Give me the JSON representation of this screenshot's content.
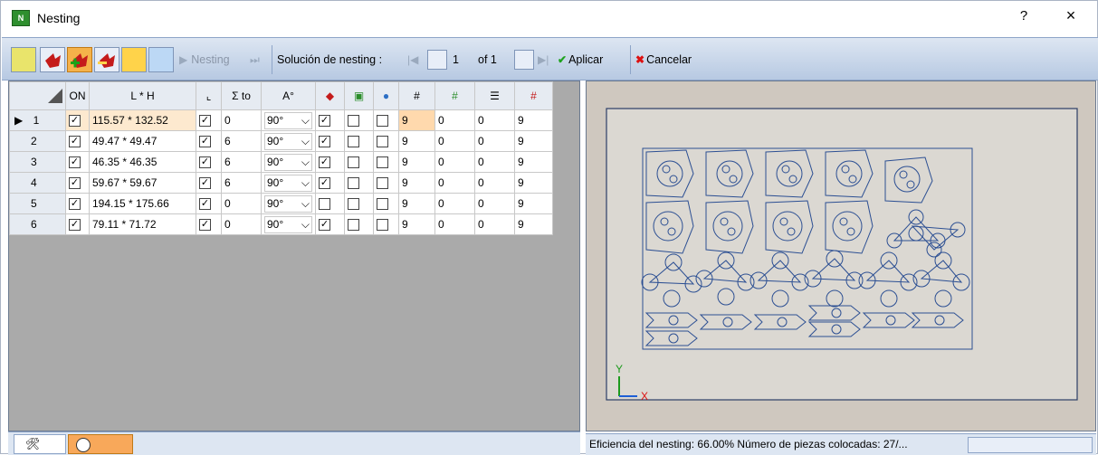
{
  "window": {
    "title": "Nesting",
    "help": "?",
    "close": "×"
  },
  "toolbar": {
    "nesting_label": "Nesting",
    "solution_label": "Solución de nesting :",
    "page_current": "1",
    "page_of": "of 1",
    "apply_label": "Aplicar",
    "cancel_label": "Cancelar"
  },
  "grid": {
    "headers": [
      "ON",
      "L * H",
      "Σ to",
      "A°",
      "#"
    ],
    "rows": [
      {
        "n": "1",
        "dim": "115.57 * 132.52",
        "sum": "0",
        "angle": "90°",
        "q": "9",
        "a": "0",
        "b": "0",
        "c": "9"
      },
      {
        "n": "2",
        "dim": "49.47 * 49.47",
        "sum": "6",
        "angle": "90°",
        "q": "9",
        "a": "0",
        "b": "0",
        "c": "9"
      },
      {
        "n": "3",
        "dim": "46.35 * 46.35",
        "sum": "6",
        "angle": "90°",
        "q": "9",
        "a": "0",
        "b": "0",
        "c": "9"
      },
      {
        "n": "4",
        "dim": "59.67 * 59.67",
        "sum": "6",
        "angle": "90°",
        "q": "9",
        "a": "0",
        "b": "0",
        "c": "9"
      },
      {
        "n": "5",
        "dim": "194.15 * 175.66",
        "sum": "0",
        "angle": "90°",
        "q": "9",
        "a": "0",
        "b": "0",
        "c": "9"
      },
      {
        "n": "6",
        "dim": "79.11 * 71.72",
        "sum": "0",
        "angle": "90°",
        "q": "9",
        "a": "0",
        "b": "0",
        "c": "9"
      }
    ]
  },
  "preview": {
    "axis_x": "X",
    "axis_y": "Y"
  },
  "status": {
    "text": "Eficiencia del nesting: 66.00%  Número de piezas colocadas: 27/..."
  }
}
